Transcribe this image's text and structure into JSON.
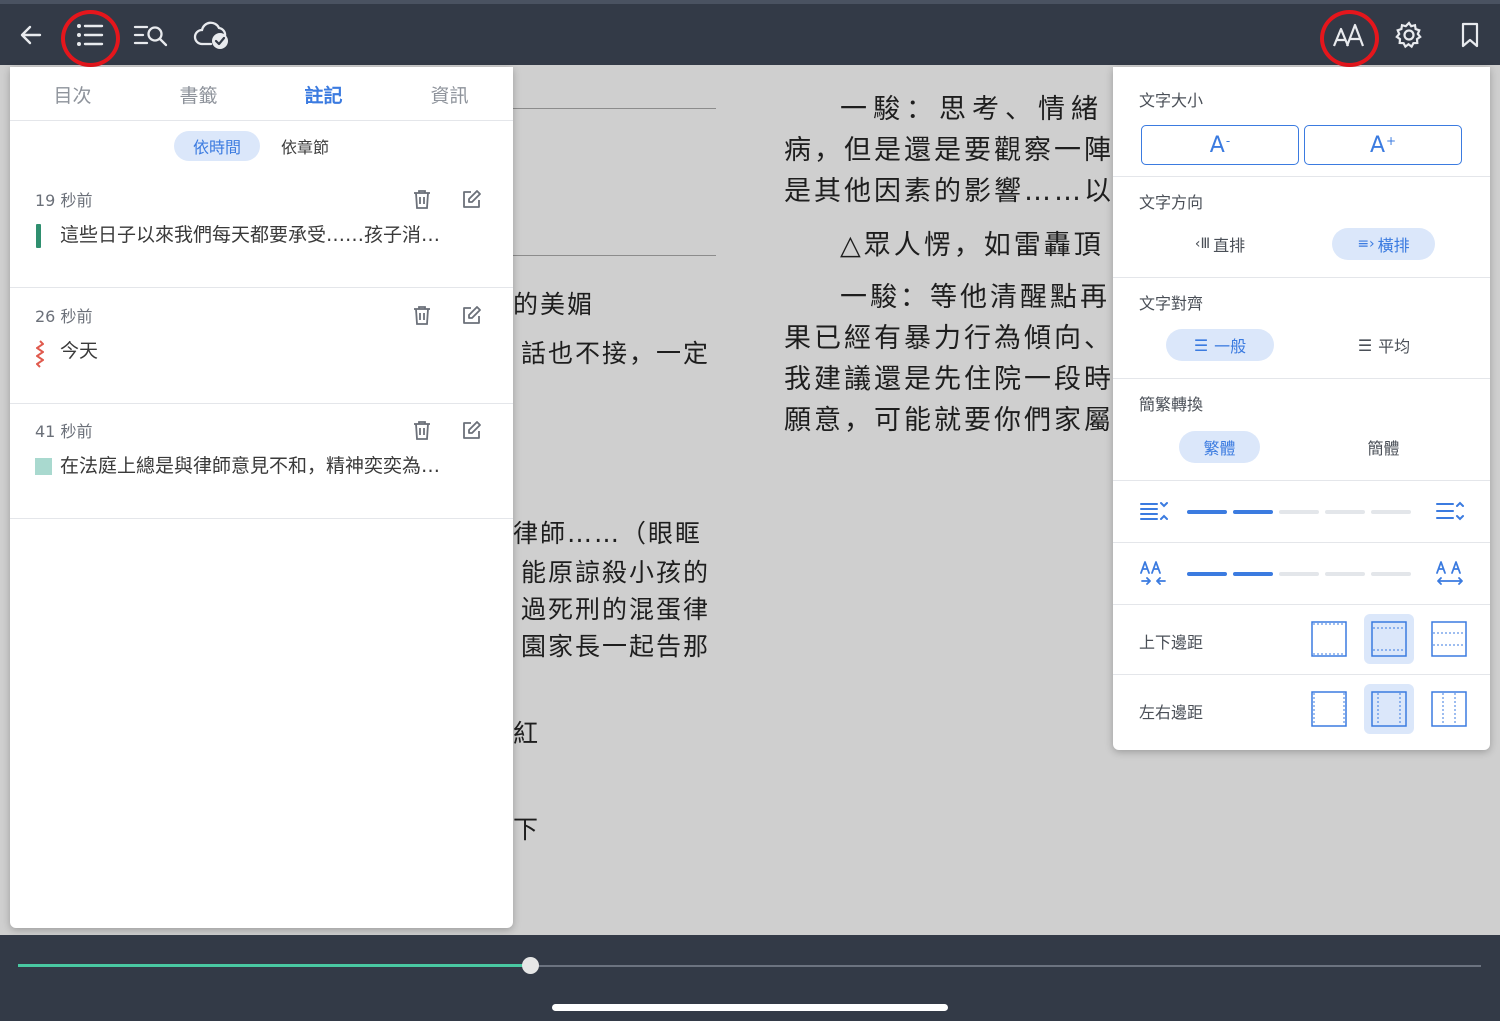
{
  "toolbar": {
    "icons": [
      "back-arrow-icon",
      "toc-list-icon",
      "search-in-book-icon",
      "cloud-sync-icon",
      "font-settings-icon",
      "gear-icon",
      "bookmark-icon"
    ],
    "highlighted": [
      "toc-list-icon",
      "font-settings-icon"
    ],
    "highlight_color": "#e5161c"
  },
  "page_left_visible": {
    "lines": [
      "的美媚",
      "話也不接，一定",
      "律師……（眼眶",
      "能原諒殺小孩的",
      "過死刑的混蛋律",
      "園家長一起告那",
      "紅",
      "下"
    ]
  },
  "page_right": {
    "lines": [
      "一駿：思考、情緒",
      "病，但是還是要觀察一陣",
      "是其他因素的影響……以",
      "△眾人愣，如雷轟頂",
      "一駿：等他清醒點再",
      "果已經有暴力行為傾向、",
      "我建議還是先住院一段時",
      "願意，可能就要你們家屬"
    ]
  },
  "notes_panel": {
    "tabs": [
      {
        "label": "目次",
        "active": false
      },
      {
        "label": "書籤",
        "active": false
      },
      {
        "label": "註記",
        "active": true
      },
      {
        "label": "資訊",
        "active": false
      }
    ],
    "sort": {
      "by_time": "依時間",
      "by_chapter": "依章節",
      "selected": "依時間"
    },
    "notes": [
      {
        "time": "19 秒前",
        "text": "這些日子以來我們每天都要承受……孩子消…",
        "mark": "bar",
        "color": "#2f8f6f"
      },
      {
        "time": "26 秒前",
        "text": "今天",
        "mark": "wavy",
        "color": "#e05a4e"
      },
      {
        "time": "41 秒前",
        "text": "在法庭上總是與律師意見不和，精神奕奕為…",
        "mark": "block",
        "color": "#a9d9cf"
      }
    ]
  },
  "settings": {
    "font_size": {
      "title": "文字大小",
      "decrease": "A",
      "increase": "A",
      "dec_sup": "-",
      "inc_sup": "+"
    },
    "direction": {
      "title": "文字方向",
      "vertical": "直排",
      "horizontal": "橫排",
      "selected": "橫排"
    },
    "align": {
      "title": "文字對齊",
      "normal": "一般",
      "justify": "平均",
      "selected": "一般"
    },
    "convert": {
      "title": "簡繁轉換",
      "trad": "繁體",
      "simp": "簡體",
      "selected": "繁體"
    },
    "line_spacing_level": 2,
    "letter_spacing_level": 2,
    "slider_steps": 5,
    "vmargin": {
      "title": "上下邊距",
      "selected": 1
    },
    "hmargin": {
      "title": "左右邊距",
      "selected": 1
    },
    "accent": "#3b7be0"
  },
  "progress": {
    "fraction": 0.35,
    "fill_color": "#49c8a2"
  }
}
